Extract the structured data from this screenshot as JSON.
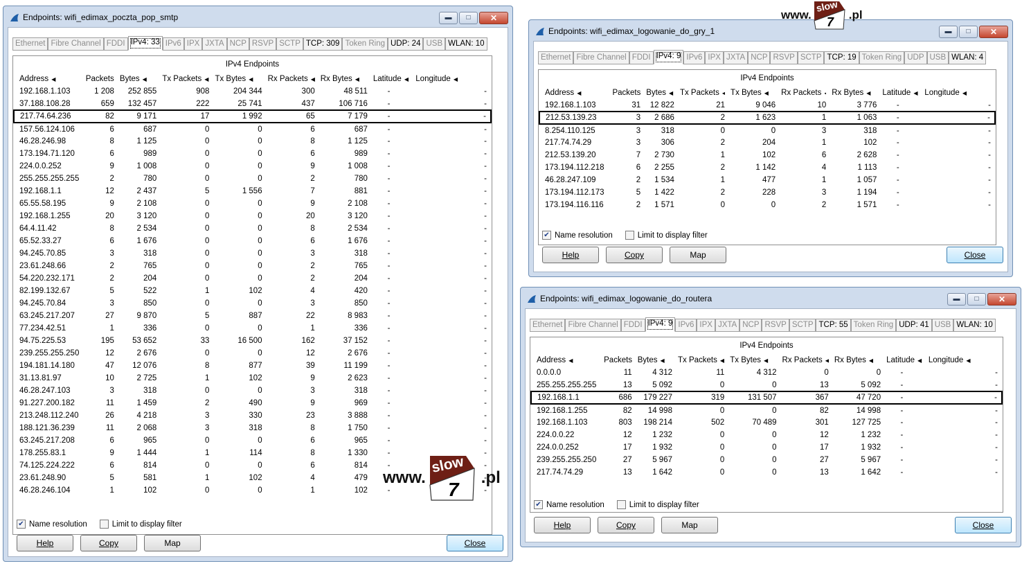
{
  "tabs_labels": [
    "Ethernet",
    "Fibre Channel",
    "FDDI",
    "IPv4",
    "IPv6",
    "IPX",
    "JXTA",
    "NCP",
    "RSVP",
    "SCTP",
    "TCP",
    "Token Ring",
    "UDP",
    "USB",
    "WLAN"
  ],
  "common": {
    "panel_title": "IPv4 Endpoints",
    "columns": [
      "Address",
      "Packets",
      "Bytes",
      "Tx Packets",
      "Tx Bytes",
      "Rx Packets",
      "Rx Bytes",
      "Latitude",
      "Longitude"
    ],
    "name_resolution": "Name resolution",
    "limit_filter": "Limit to display filter",
    "help": "Help",
    "copy": "Copy",
    "map": "Map",
    "close": "Close",
    "dash": "-"
  },
  "watermark": {
    "www": "www.",
    "slow": "slow",
    "seven": "7",
    "pl": ".pl"
  },
  "windows": [
    {
      "title": "Endpoints: wifi_edimax_poczta_pop_smtp",
      "tabs": [
        "Ethernet",
        "Fibre Channel",
        "FDDI",
        "IPv4: 33",
        "IPv6",
        "IPX",
        "JXTA",
        "NCP",
        "RSVP",
        "SCTP",
        "TCP: 309",
        "Token Ring",
        "UDP: 24",
        "USB",
        "WLAN: 10"
      ],
      "rows": [
        [
          "192.168.1.103",
          "1 208",
          "252 855",
          "908",
          "204 344",
          "300",
          "48 511"
        ],
        [
          "37.188.108.28",
          "659",
          "132 457",
          "222",
          "25 741",
          "437",
          "106 716"
        ],
        [
          "217.74.64.236",
          "82",
          "9 171",
          "17",
          "1 992",
          "65",
          "7 179"
        ],
        [
          "157.56.124.106",
          "6",
          "687",
          "0",
          "0",
          "6",
          "687"
        ],
        [
          "46.28.246.98",
          "8",
          "1 125",
          "0",
          "0",
          "8",
          "1 125"
        ],
        [
          "173.194.71.120",
          "6",
          "989",
          "0",
          "0",
          "6",
          "989"
        ],
        [
          "224.0.0.252",
          "9",
          "1 008",
          "0",
          "0",
          "9",
          "1 008"
        ],
        [
          "255.255.255.255",
          "2",
          "780",
          "0",
          "0",
          "2",
          "780"
        ],
        [
          "192.168.1.1",
          "12",
          "2 437",
          "5",
          "1 556",
          "7",
          "881"
        ],
        [
          "65.55.58.195",
          "9",
          "2 108",
          "0",
          "0",
          "9",
          "2 108"
        ],
        [
          "192.168.1.255",
          "20",
          "3 120",
          "0",
          "0",
          "20",
          "3 120"
        ],
        [
          "64.4.11.42",
          "8",
          "2 534",
          "0",
          "0",
          "8",
          "2 534"
        ],
        [
          "65.52.33.27",
          "6",
          "1 676",
          "0",
          "0",
          "6",
          "1 676"
        ],
        [
          "94.245.70.85",
          "3",
          "318",
          "0",
          "0",
          "3",
          "318"
        ],
        [
          "23.61.248.66",
          "2",
          "765",
          "0",
          "0",
          "2",
          "765"
        ],
        [
          "54.220.232.171",
          "2",
          "204",
          "0",
          "0",
          "2",
          "204"
        ],
        [
          "82.199.132.67",
          "5",
          "522",
          "1",
          "102",
          "4",
          "420"
        ],
        [
          "94.245.70.84",
          "3",
          "850",
          "0",
          "0",
          "3",
          "850"
        ],
        [
          "63.245.217.207",
          "27",
          "9 870",
          "5",
          "887",
          "22",
          "8 983"
        ],
        [
          "77.234.42.51",
          "1",
          "336",
          "0",
          "0",
          "1",
          "336"
        ],
        [
          "94.75.225.53",
          "195",
          "53 652",
          "33",
          "16 500",
          "162",
          "37 152"
        ],
        [
          "239.255.255.250",
          "12",
          "2 676",
          "0",
          "0",
          "12",
          "2 676"
        ],
        [
          "194.181.14.180",
          "47",
          "12 076",
          "8",
          "877",
          "39",
          "11 199"
        ],
        [
          "31.13.81.97",
          "10",
          "2 725",
          "1",
          "102",
          "9",
          "2 623"
        ],
        [
          "46.28.247.103",
          "3",
          "318",
          "0",
          "0",
          "3",
          "318"
        ],
        [
          "91.227.200.182",
          "11",
          "1 459",
          "2",
          "490",
          "9",
          "969"
        ],
        [
          "213.248.112.240",
          "26",
          "4 218",
          "3",
          "330",
          "23",
          "3 888"
        ],
        [
          "188.121.36.239",
          "11",
          "2 068",
          "3",
          "318",
          "8",
          "1 750"
        ],
        [
          "63.245.217.208",
          "6",
          "965",
          "0",
          "0",
          "6",
          "965"
        ],
        [
          "178.255.83.1",
          "9",
          "1 444",
          "1",
          "114",
          "8",
          "1 330"
        ],
        [
          "74.125.224.222",
          "6",
          "814",
          "0",
          "0",
          "6",
          "814"
        ],
        [
          "23.61.248.90",
          "5",
          "581",
          "1",
          "102",
          "4",
          "479"
        ],
        [
          "46.28.246.104",
          "1",
          "102",
          "0",
          "0",
          "1",
          "102"
        ]
      ],
      "highlight_row": 2
    },
    {
      "title": "Endpoints: wifi_edimax_logowanie_do_gry_1",
      "tabs": [
        "Ethernet",
        "Fibre Channel",
        "FDDI",
        "IPv4: 9",
        "IPv6",
        "IPX",
        "JXTA",
        "NCP",
        "RSVP",
        "SCTP",
        "TCP: 19",
        "Token Ring",
        "UDP",
        "USB",
        "WLAN: 4"
      ],
      "rows": [
        [
          "192.168.1.103",
          "31",
          "12 822",
          "21",
          "9 046",
          "10",
          "3 776"
        ],
        [
          "212.53.139.23",
          "3",
          "2 686",
          "2",
          "1 623",
          "1",
          "1 063"
        ],
        [
          "8.254.110.125",
          "3",
          "318",
          "0",
          "0",
          "3",
          "318"
        ],
        [
          "217.74.74.29",
          "3",
          "306",
          "2",
          "204",
          "1",
          "102"
        ],
        [
          "212.53.139.20",
          "7",
          "2 730",
          "1",
          "102",
          "6",
          "2 628"
        ],
        [
          "173.194.112.218",
          "6",
          "2 255",
          "2",
          "1 142",
          "4",
          "1 113"
        ],
        [
          "46.28.247.109",
          "2",
          "1 534",
          "1",
          "477",
          "1",
          "1 057"
        ],
        [
          "173.194.112.173",
          "5",
          "1 422",
          "2",
          "228",
          "3",
          "1 194"
        ],
        [
          "173.194.116.116",
          "2",
          "1 571",
          "0",
          "0",
          "2",
          "1 571"
        ]
      ],
      "highlight_row": 1
    },
    {
      "title": "Endpoints: wifi_edimax_logowanie_do_routera",
      "tabs": [
        "Ethernet",
        "Fibre Channel",
        "FDDI",
        "IPv4: 9",
        "IPv6",
        "IPX",
        "JXTA",
        "NCP",
        "RSVP",
        "SCTP",
        "TCP: 55",
        "Token Ring",
        "UDP: 41",
        "USB",
        "WLAN: 10"
      ],
      "rows": [
        [
          "0.0.0.0",
          "11",
          "4 312",
          "11",
          "4 312",
          "0",
          "0"
        ],
        [
          "255.255.255.255",
          "13",
          "5 092",
          "0",
          "0",
          "13",
          "5 092"
        ],
        [
          "192.168.1.1",
          "686",
          "179 227",
          "319",
          "131 507",
          "367",
          "47 720"
        ],
        [
          "192.168.1.255",
          "82",
          "14 998",
          "0",
          "0",
          "82",
          "14 998"
        ],
        [
          "192.168.1.103",
          "803",
          "198 214",
          "502",
          "70 489",
          "301",
          "127 725"
        ],
        [
          "224.0.0.22",
          "12",
          "1 232",
          "0",
          "0",
          "12",
          "1 232"
        ],
        [
          "224.0.0.252",
          "17",
          "1 932",
          "0",
          "0",
          "17",
          "1 932"
        ],
        [
          "239.255.255.250",
          "27",
          "5 967",
          "0",
          "0",
          "27",
          "5 967"
        ],
        [
          "217.74.74.29",
          "13",
          "1 642",
          "0",
          "0",
          "13",
          "1 642"
        ]
      ],
      "highlight_row": 2
    }
  ]
}
